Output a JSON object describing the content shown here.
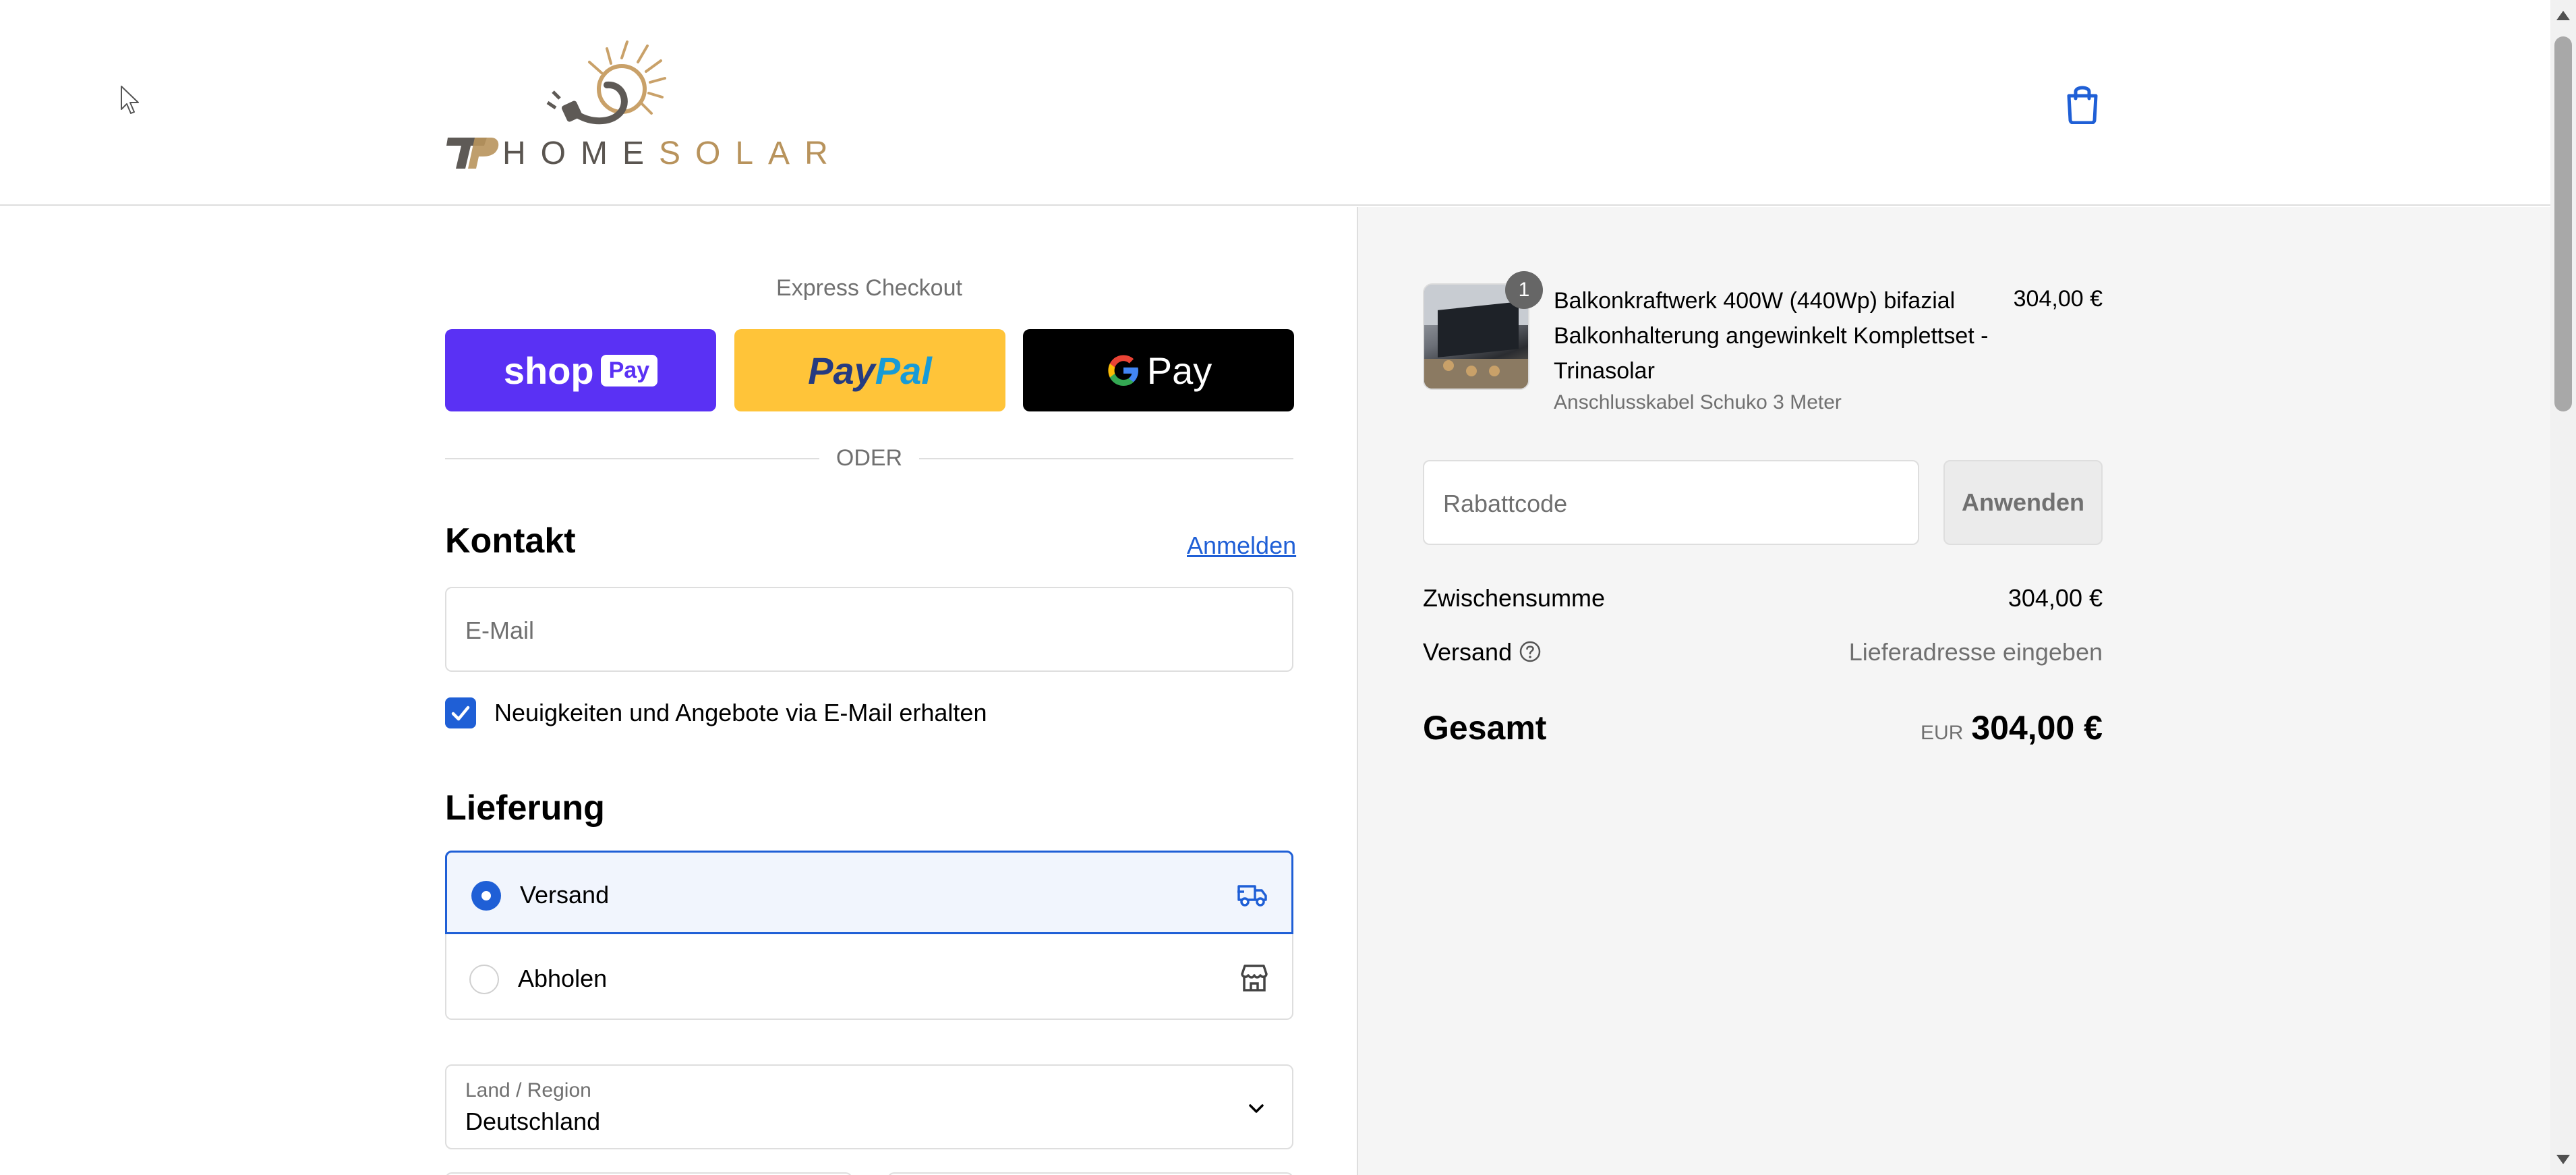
{
  "header": {
    "logo_text_a": "HOME",
    "logo_text_b": "SOLAR",
    "cart_icon": "shopping-bag-icon"
  },
  "express": {
    "label": "Express Checkout",
    "shop_pay_text": "shop",
    "shop_pay_badge": "Pay",
    "paypal_text": "PayPal",
    "gpay_text": "Pay",
    "divider_text": "ODER"
  },
  "contact": {
    "title": "Kontakt",
    "login_link": "Anmelden",
    "email_placeholder": "E-Mail",
    "newsletter_label": "Neuigkeiten und Angebote via E-Mail erhalten",
    "newsletter_checked": true
  },
  "delivery": {
    "title": "Lieferung",
    "options": [
      {
        "label": "Versand",
        "selected": true,
        "icon": "truck-icon"
      },
      {
        "label": "Abholen",
        "selected": false,
        "icon": "store-icon"
      }
    ],
    "country_label": "Land / Region",
    "country_value": "Deutschland"
  },
  "summary": {
    "product": {
      "quantity": "1",
      "title": "Balkonkraftwerk 400W (440Wp) bifazial Balkonhalterung angewinkelt Komplettset - Trinasolar",
      "variant": "Anschlusskabel Schuko 3 Meter",
      "price": "304,00 €"
    },
    "discount_placeholder": "Rabattcode",
    "apply_label": "Anwenden",
    "subtotal_label": "Zwischensumme",
    "subtotal_value": "304,00 €",
    "shipping_label": "Versand",
    "shipping_value": "Lieferadresse eingeben",
    "total_label": "Gesamt",
    "total_currency": "EUR",
    "total_value": "304,00 €"
  },
  "colors": {
    "accent": "#1f5fd6",
    "shop_pay": "#5a31f4",
    "paypal": "#ffc439",
    "gpay": "#000000",
    "summary_bg": "#f5f5f5"
  }
}
